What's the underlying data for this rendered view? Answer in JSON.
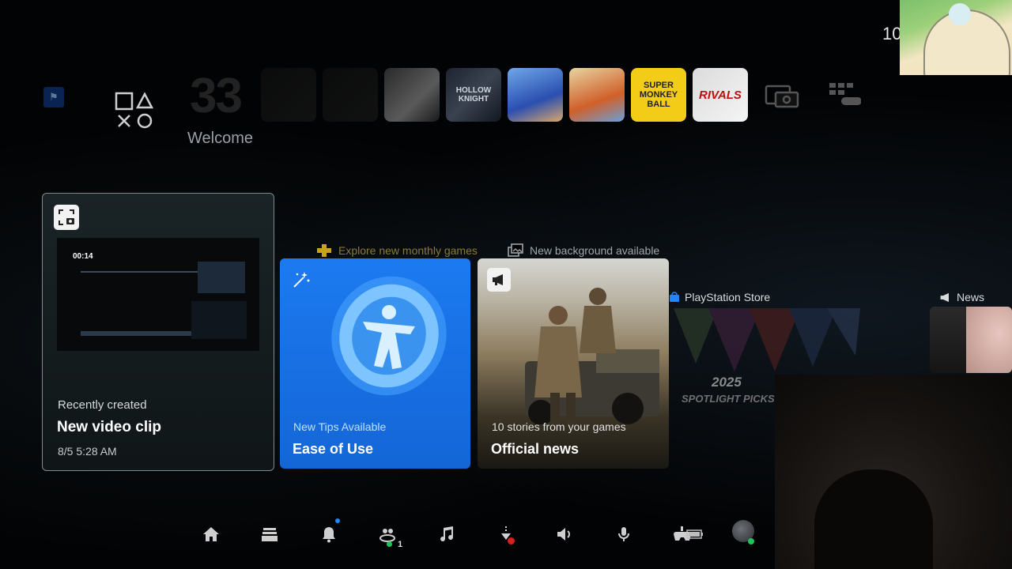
{
  "clock": "10",
  "top_bar": {
    "welcome_label": "Welcome",
    "big_number": "33",
    "tiles": [
      {
        "name": "game-tile-dim-1",
        "label": ""
      },
      {
        "name": "game-tile-dim-2",
        "label": ""
      },
      {
        "name": "game-tile-dark-souls",
        "label": ""
      },
      {
        "name": "game-tile-hollow-knight",
        "label": "HOLLOW KNIGHT"
      },
      {
        "name": "game-tile-astro",
        "label": ""
      },
      {
        "name": "game-tile-party",
        "label": ""
      },
      {
        "name": "game-tile-super-monkey-ball",
        "label": "SUPER MONKEY BALL"
      },
      {
        "name": "game-tile-marvel-rivals",
        "label": "RIVALS"
      }
    ]
  },
  "cards": {
    "clip": {
      "thumb_time": "00:14",
      "subtitle": "Recently created",
      "title": "New video clip",
      "date": "8/5  5:28 AM"
    },
    "hint_monthly": "Explore new monthly games",
    "hint_background": "New background available",
    "tips": {
      "subtitle": "New Tips Available",
      "title": "Ease of Use"
    },
    "news": {
      "subtitle": "10 stories from your games",
      "title": "Official news"
    },
    "store": {
      "label": "PlayStation Store",
      "year": "2025",
      "spotlight": "SPOTLIGHT PICKS"
    },
    "news_label": "News"
  },
  "dock": {
    "friends_count": "1"
  },
  "colors": {
    "tips_blue": "#1c7af0",
    "ps_plus_yellow": "#f2cc16",
    "online_green": "#1ec45a",
    "notif_blue": "#1f86ff"
  }
}
